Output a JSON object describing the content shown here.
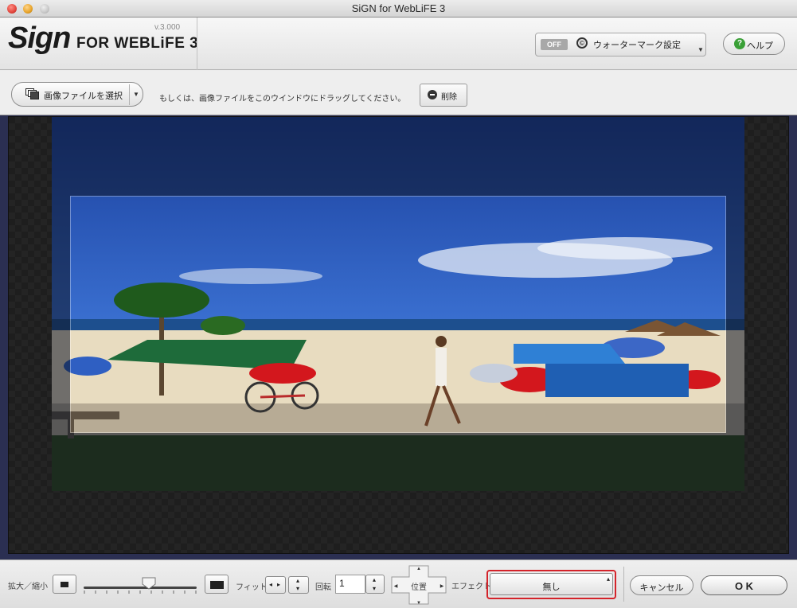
{
  "window": {
    "title": "SiGN for WebLiFE 3"
  },
  "header": {
    "logo_main": "Sign",
    "logo_sub": "FOR WEBLiFE 3",
    "version": "v.3.000",
    "watermark": {
      "toggle": "OFF",
      "icon": "©",
      "label": "ウォーターマーク設定"
    },
    "help": {
      "icon": "?",
      "label": "ヘルプ"
    }
  },
  "toolbar": {
    "select_file": "画像ファイルを選択",
    "drag_hint": "もしくは、画像ファイルをこのウインドウにドラッグしてください。",
    "delete": "削除"
  },
  "bottom": {
    "zoom_label": "拡大／縮小",
    "zoom_level": 0.58,
    "fit_label": "フィット",
    "rotate_label": "回転",
    "rotate_value": "1",
    "position_label": "位置",
    "effect_label": "エフェクト",
    "effect_value": "無し",
    "cancel": "キャンセル",
    "ok": "O K"
  },
  "colors": {
    "accent_red": "#d4232a",
    "canvas_bg": "#2b2f52",
    "help_green": "#3aa037"
  }
}
